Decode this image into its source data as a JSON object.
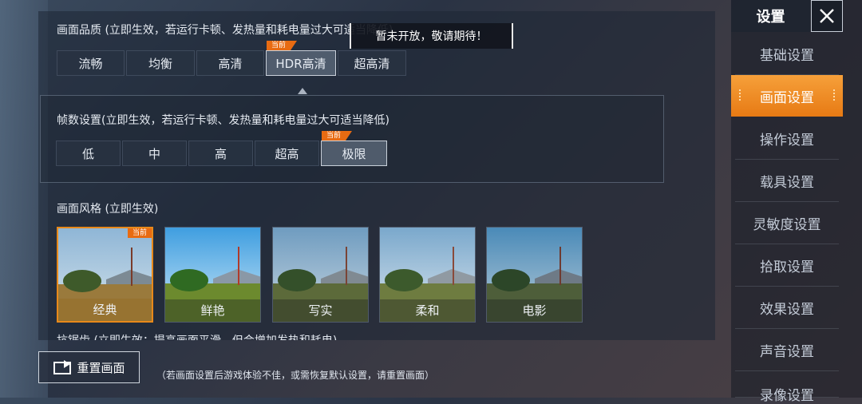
{
  "quality": {
    "title": "画面品质 (立即生效，若运行卡顿、发热量和耗电量过大可适当降低)",
    "options": [
      "流畅",
      "均衡",
      "高清",
      "HDR高清",
      "超高清"
    ],
    "current_badge": "当前",
    "tooltip": "暂未开放，敬请期待！"
  },
  "fps": {
    "title": "帧数设置(立即生效，若运行卡顿、发热量和耗电量过大可适当降低)",
    "options": [
      "低",
      "中",
      "高",
      "超高",
      "极限"
    ],
    "current_badge": "当前"
  },
  "style": {
    "title": "画面风格 (立即生效)",
    "options": [
      "经典",
      "鲜艳",
      "写实",
      "柔和",
      "电影"
    ],
    "current_badge": "当前"
  },
  "antialias": {
    "title_cut": "抗锯齿 (立即生效：提高画面平滑，但会增加发热和耗电)"
  },
  "sidebar": {
    "title": "设置",
    "items": [
      "基础设置",
      "画面设置",
      "操作设置",
      "载具设置",
      "灵敏度设置",
      "拾取设置",
      "效果设置",
      "声音设置",
      "录像设置"
    ]
  },
  "footer": {
    "reset_label": "重置画面",
    "note": "（若画面设置后游戏体验不佳，或需恢复默认设置，请重置画面）"
  },
  "colors": {
    "accent": "#e77a14",
    "badge": "#e86b12"
  }
}
